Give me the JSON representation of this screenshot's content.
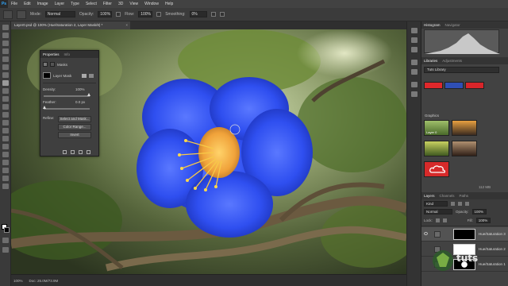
{
  "app": {
    "logo": "Ps"
  },
  "menu": {
    "items": [
      "File",
      "Edit",
      "Image",
      "Layer",
      "Type",
      "Select",
      "Filter",
      "3D",
      "View",
      "Window",
      "Help"
    ]
  },
  "options_bar": {
    "mode_label": "Mode:",
    "mode_value": "Normal",
    "opacity_label": "Opacity:",
    "opacity_value": "100%",
    "flow_label": "Flow:",
    "flow_value": "100%",
    "smoothing_label": "Smoothing:",
    "smoothing_value": "0%"
  },
  "document": {
    "tab_title": "Layer0.psd @ 100% (Hue/Saturation 2, Layer Mask/8) *",
    "close_glyph": "×",
    "zoom": "100%",
    "doc_size": "Doc: 25.0M/73.9M"
  },
  "properties": {
    "tabs": [
      "Properties",
      "Info"
    ],
    "section_title": "Masks",
    "mask_label": "Layer Mask",
    "density_label": "Density:",
    "density_value": "100%",
    "feather_label": "Feather:",
    "feather_value": "0.0 px",
    "refine_label": "Refine:",
    "select_mask_button": "Select and Mask...",
    "color_range_button": "Color Range...",
    "invert_button": "Invert"
  },
  "histogram_panel": {
    "tabs": [
      "Histogram",
      "Navigator"
    ]
  },
  "libraries_panel": {
    "tabs": [
      "Libraries",
      "Adjustments"
    ],
    "library_name": "Tuts Library",
    "colors": [
      "#e0282b",
      "#2f4fb5",
      "#d8252a"
    ],
    "graphics_title": "Graphics",
    "layer_caption": "Layer 0",
    "size_text": "112 MB"
  },
  "layers_panel": {
    "tabs": [
      "Layers",
      "Channels",
      "Paths"
    ],
    "kind_label": "Kind",
    "blend_mode": "Normal",
    "opacity_label": "Opacity:",
    "opacity_value": "100%",
    "lock_label": "Lock:",
    "fill_label": "Fill:",
    "fill_value": "100%",
    "layers": [
      {
        "name": "Hue/Saturation 3",
        "visible": true
      },
      {
        "name": "Hue/Saturation 2",
        "visible": false
      },
      {
        "name": "Hue/Saturation 1",
        "visible": false
      }
    ]
  },
  "watermark": {
    "text": "tuts"
  }
}
